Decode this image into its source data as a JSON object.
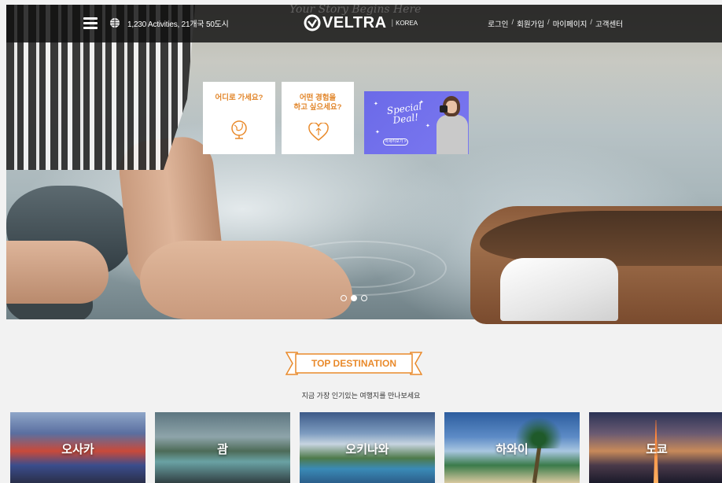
{
  "header": {
    "activities": "1,230 Activities, 21개국 50도시",
    "tagline": "Your Story Begins Here",
    "logo": "VELTRA",
    "logo_separator": "|",
    "region": "KOREA",
    "links": [
      "로그인",
      "회원가입",
      "마이페이지",
      "고객센터"
    ],
    "link_separator": "/"
  },
  "cards": [
    {
      "title": "어디로 가세요?",
      "icon": "globe-icon"
    },
    {
      "title": "어떤 경험을\n하고 싶으세요?",
      "icon": "heart-icon"
    }
  ],
  "promo": {
    "title": "Special Deal!",
    "button": "자세히보기 >"
  },
  "carousel": {
    "slides": 3,
    "active_index": 1
  },
  "section": {
    "title": "TOP DESTINATION",
    "subtitle": "지금 가장 인기있는 여행지를 만나보세요"
  },
  "destinations": [
    {
      "label": "오사카"
    },
    {
      "label": "괌"
    },
    {
      "label": "오키나와"
    },
    {
      "label": "하와이"
    },
    {
      "label": "도쿄"
    }
  ],
  "colors": {
    "accent": "#e98a2b",
    "header_bg": "#0f0f0f",
    "promo_bg": "#6b6ae8"
  }
}
